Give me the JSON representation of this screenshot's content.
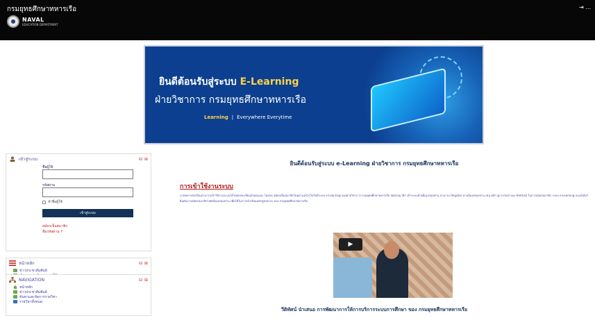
{
  "header": {
    "site_title": "กรมยุทธศึกษาทหารเรือ",
    "login_text": "⇥ ...",
    "logo_main": "NAVAL",
    "logo_sub": "EDUCATION DEPARTMENT"
  },
  "banner": {
    "line1_prefix": "ยินดีต้อนรับสู่ระบบ ",
    "line1_highlight": "E-Learning",
    "line2": "ฝ่ายวิชาการ กรมยุทธศึกษาทหารเรือ",
    "tag_left": "Learning",
    "tag_right": "Everywhere Everytime"
  },
  "login_block": {
    "title": "เข้าสู่ระบบ",
    "username_label": "ชื่อผู้ใช้",
    "password_label": "รหัสผ่าน",
    "remember_label": "จำชื่อผู้ใช้",
    "login_button": "เข้าสู่ระบบ",
    "link_signup": "สมัครเป็นสมาชิก",
    "link_forgot": "ลืมรหัสผ่าน ?"
  },
  "main_menu": {
    "title": "หน้าหลัก",
    "items": [
      "ข่าวประชาสัมพันธ์",
      "คำถามและคำตอบการใช้งาน"
    ]
  },
  "navigation": {
    "title": "NAVIGATION",
    "items": [
      "หน้าหลัก",
      "ข่าวประชาสัมพันธ์",
      "ค้นหาและจัดการรายวิชา",
      "รายวิชาทั้งหมด"
    ]
  },
  "main": {
    "welcome": "ยินดีต้อนรับสู่ระบบ  e-Learning ฝ่ายวิชาการ กรมยุทธศึกษาทหารเรือ",
    "usage_title": "การเข้าใช้งานระบบ",
    "usage_body": "นายทหารนักเรียนสามารถเข้าใช้งานระบบได้โดยลงทะเบียนด้วยตนเอง โดยกด สมัครเป็นสมาชิกใหม่ผ่านหน้าเว็บไซต์ระบบ e-Learning ของฝ่ายวิชาการ กรมยุทธศึกษาทหารเรือ สมัครสมาชิก เข้าระบบด้วยอีเมลของท่าน สามารถ Register ผ่านอีเมลของท่าน เช่น คลิก @ e-mail ของ Hotmail ในการสมัครสมาชิก ระบบ e-Learning จะแจ้งลิงก์ยืนยันการสมัครสมาชิกไปยังอีเมลของท่าน เพื่อใช้ในการเข้าเรียนหลักสูตรต่างๆ ของ กรมยุทธศึกษาทหารเรือ",
    "video_caption": "วีดิทัศน์ นำเสนอ การพัฒนาการให้การบริการระบบการศึกษา ของ กรมยุทธศึกษาทหารเรือ"
  },
  "colors": {
    "topbar": "#070707",
    "banner_bg": "#0c3f8f",
    "accent_yellow": "#ffd24a",
    "button_navy": "#133257",
    "usage_title_red": "#b71c1c"
  }
}
